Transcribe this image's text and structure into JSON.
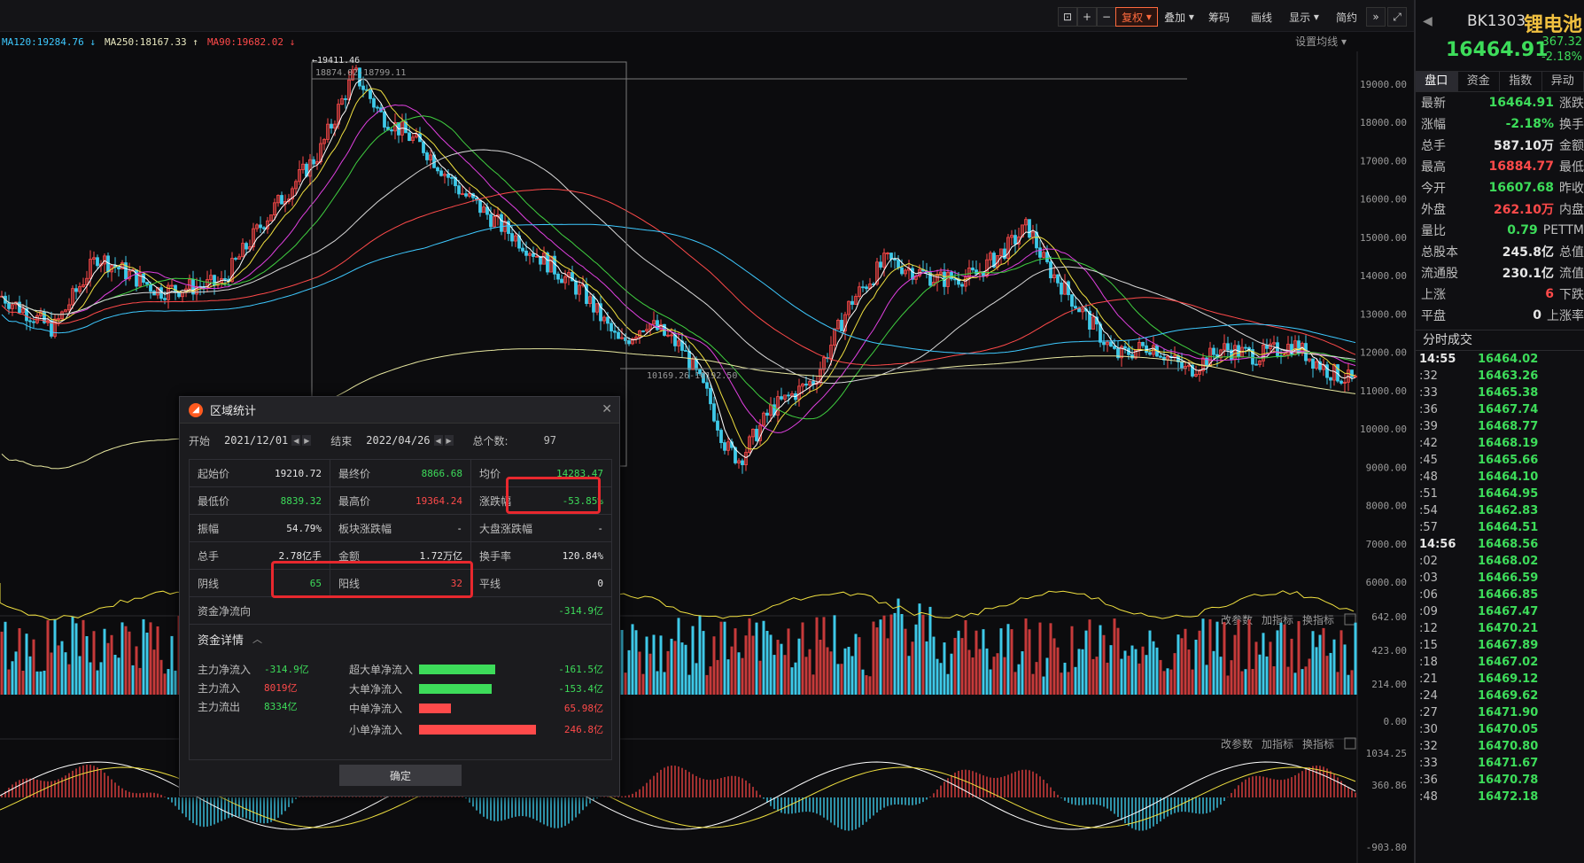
{
  "toolbar": {
    "fuquan": "复权",
    "diejia": "叠加",
    "chouma": "筹码",
    "huaxian": "画线",
    "xianshi": "显示",
    "jianyue": "简约",
    "setline": "设置均线"
  },
  "ma_legend": [
    {
      "label": "MA120:19284.76",
      "arrow": "↓",
      "color": "#3ec9ff"
    },
    {
      "label": "MA250:18167.33",
      "arrow": "↑",
      "color": "#e8e8c0"
    },
    {
      "label": "MA90:19682.02",
      "arrow": "↓",
      "color": "#ff4a4a"
    }
  ],
  "chart_labels": {
    "high_marker": "19411.46",
    "range_top": "18874.02-18799.11",
    "range_bottom": "10169.26-10192.50"
  },
  "price_axis": [
    "19000.00",
    "18000.00",
    "17000.00",
    "16000.00",
    "15000.00",
    "14000.00",
    "13000.00",
    "12000.00",
    "11000.00",
    "10000.00",
    "9000.00",
    "8000.00",
    "7000.00",
    "6000.00"
  ],
  "vol_axis": [
    "642.00",
    "423.00",
    "214.00",
    "0.00"
  ],
  "macd_axis": [
    "1034.25",
    "360.86",
    "-903.80"
  ],
  "sub_panel_links": {
    "gaicanshu": "改参数",
    "jiazhibiao": "加指标",
    "huanzhibiao": "换指标"
  },
  "side": {
    "code": "BK1303",
    "name": "锂电池",
    "price": "16464.91",
    "change": "-367.32",
    "change_pct": "-2.18%",
    "tabs": [
      "盘口",
      "资金",
      "指数",
      "异动"
    ],
    "quotes": [
      {
        "k": "最新",
        "v": "16464.91",
        "c": "g",
        "k2": "涨跌"
      },
      {
        "k": "涨幅",
        "v": "-2.18%",
        "c": "g",
        "k2": "换手"
      },
      {
        "k": "总手",
        "v": "587.10万",
        "c": "w",
        "k2": "金额"
      },
      {
        "k": "最高",
        "v": "16884.77",
        "c": "r",
        "k2": "最低"
      },
      {
        "k": "今开",
        "v": "16607.68",
        "c": "g",
        "k2": "昨收"
      },
      {
        "k": "外盘",
        "v": "262.10万",
        "c": "r",
        "k2": "内盘"
      },
      {
        "k": "量比",
        "v": "0.79",
        "c": "g",
        "k2": "PETTM"
      },
      {
        "k": "总股本",
        "v": "245.8亿",
        "c": "w",
        "k2": "总值"
      },
      {
        "k": "流通股",
        "v": "230.1亿",
        "c": "w",
        "k2": "流值"
      },
      {
        "k": "上涨",
        "v": "6",
        "c": "r",
        "k2": "下跌"
      },
      {
        "k": "平盘",
        "v": "0",
        "c": "w",
        "k2": "上涨率"
      }
    ],
    "ticks_title": "分时成交",
    "ticks": [
      {
        "t": "14:55",
        "p": "16464.02",
        "min": true
      },
      {
        "t": ":32",
        "p": "16463.26"
      },
      {
        "t": ":33",
        "p": "16465.38"
      },
      {
        "t": ":36",
        "p": "16467.74"
      },
      {
        "t": ":39",
        "p": "16468.77"
      },
      {
        "t": ":42",
        "p": "16468.19"
      },
      {
        "t": ":45",
        "p": "16465.66"
      },
      {
        "t": ":48",
        "p": "16464.10"
      },
      {
        "t": ":51",
        "p": "16464.95"
      },
      {
        "t": ":54",
        "p": "16462.83"
      },
      {
        "t": ":57",
        "p": "16464.51"
      },
      {
        "t": "14:56",
        "p": "16468.56",
        "min": true
      },
      {
        "t": ":02",
        "p": "16468.02"
      },
      {
        "t": ":03",
        "p": "16466.59"
      },
      {
        "t": ":06",
        "p": "16466.85"
      },
      {
        "t": ":09",
        "p": "16467.47"
      },
      {
        "t": ":12",
        "p": "16470.21"
      },
      {
        "t": ":15",
        "p": "16467.89"
      },
      {
        "t": ":18",
        "p": "16467.02"
      },
      {
        "t": ":21",
        "p": "16469.12"
      },
      {
        "t": ":24",
        "p": "16469.62"
      },
      {
        "t": ":27",
        "p": "16471.90"
      },
      {
        "t": ":30",
        "p": "16470.05"
      },
      {
        "t": ":32",
        "p": "16470.80"
      },
      {
        "t": ":33",
        "p": "16471.67"
      },
      {
        "t": ":36",
        "p": "16470.78"
      },
      {
        "t": ":48",
        "p": "16472.18"
      }
    ]
  },
  "dialog": {
    "title": "区域统计",
    "start_label": "开始",
    "start": "2021/12/01",
    "end_label": "结束",
    "end": "2022/04/26",
    "count_label": "总个数:",
    "count": "97",
    "rows": [
      [
        {
          "k": "起始价",
          "v": "19210.72",
          "c": "w"
        },
        {
          "k": "最终价",
          "v": "8866.68",
          "c": "g"
        },
        {
          "k": "均价",
          "v": "14283.47",
          "c": "g"
        }
      ],
      [
        {
          "k": "最低价",
          "v": "8839.32",
          "c": "g"
        },
        {
          "k": "最高价",
          "v": "19364.24",
          "c": "r"
        },
        {
          "k": "涨跌幅",
          "v": "-53.85%",
          "c": "g"
        }
      ],
      [
        {
          "k": "振幅",
          "v": "54.79%",
          "c": "w"
        },
        {
          "k": "板块涨跌幅",
          "v": "-",
          "c": "w"
        },
        {
          "k": "大盘涨跌幅",
          "v": "-",
          "c": "w"
        }
      ],
      [
        {
          "k": "总手",
          "v": "2.78亿手",
          "c": "w"
        },
        {
          "k": "金额",
          "v": "1.72万亿",
          "c": "w"
        },
        {
          "k": "换手率",
          "v": "120.84%",
          "c": "w"
        }
      ],
      [
        {
          "k": "阴线",
          "v": "65",
          "c": "g"
        },
        {
          "k": "阳线",
          "v": "32",
          "c": "r"
        },
        {
          "k": "平线",
          "v": "0",
          "c": "w"
        }
      ]
    ],
    "net_flow_label": "资金净流向",
    "net_flow": "-314.9亿",
    "fund_title": "资金详情",
    "fund_left": [
      {
        "k": "主力净流入",
        "v": "-314.9亿",
        "c": "g"
      },
      {
        "k": "主力流入",
        "v": "8019亿",
        "c": "r"
      },
      {
        "k": "主力流出",
        "v": "8334亿",
        "c": "g"
      }
    ],
    "fund_right": [
      {
        "k": "超大单净流入",
        "v": "-161.5亿",
        "c": "g",
        "bar": 0.65,
        "color": "#3ddc5a"
      },
      {
        "k": "大单净流入",
        "v": "-153.4亿",
        "c": "g",
        "bar": 0.62,
        "color": "#3ddc5a"
      },
      {
        "k": "中单净流入",
        "v": "65.98亿",
        "c": "r",
        "bar": 0.27,
        "color": "#ff4a4a"
      },
      {
        "k": "小单净流入",
        "v": "246.8亿",
        "c": "r",
        "bar": 1.0,
        "color": "#ff4a4a"
      }
    ],
    "ok": "确定"
  }
}
